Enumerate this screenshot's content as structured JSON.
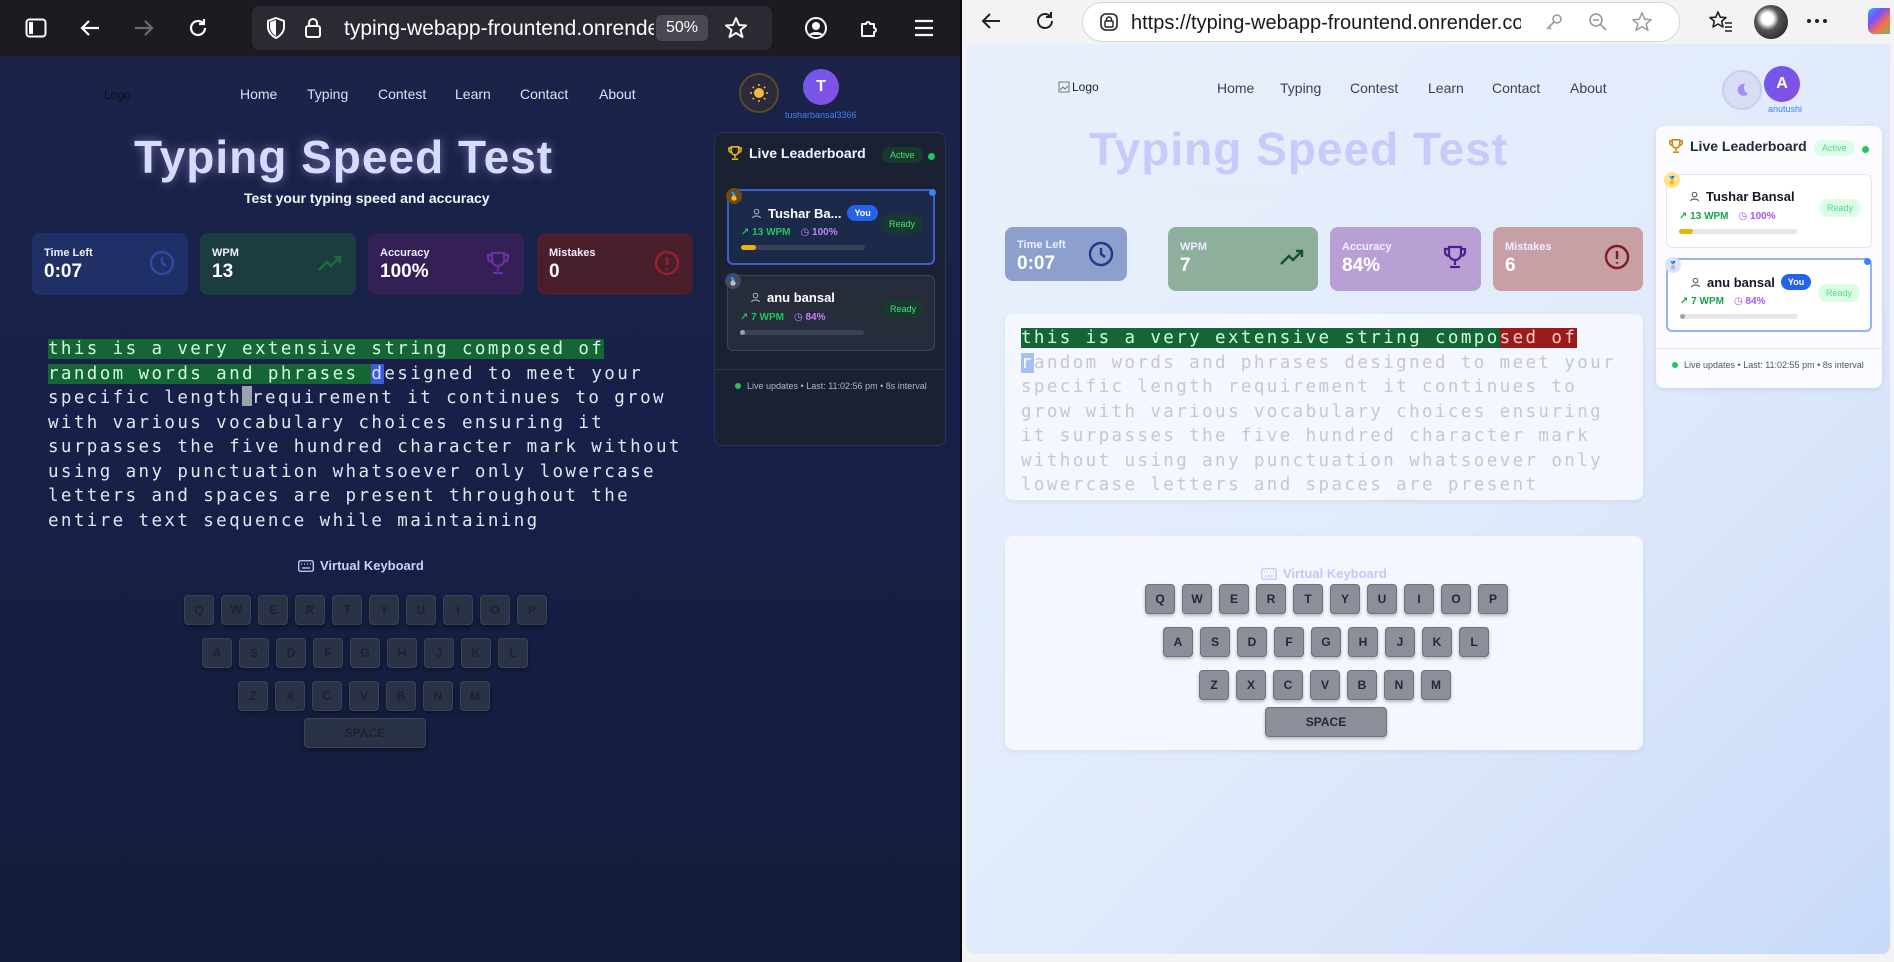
{
  "firefox": {
    "url": "typing-webapp-frountend.onrender.com",
    "zoom": "50%"
  },
  "edge": {
    "url": "https://typing-webapp-frountend.onrender.com"
  },
  "nav": {
    "logo": "Logo",
    "links": [
      "Home",
      "Typing",
      "Contest",
      "Learn",
      "Contact",
      "About"
    ]
  },
  "left": {
    "user_initial": "T",
    "username": "tusharbansal3366",
    "title": "Typing Speed Test",
    "subtitle": "Test your typing speed and accuracy",
    "stats": [
      {
        "label": "Time Left",
        "value": "0:07"
      },
      {
        "label": "WPM",
        "value": "13"
      },
      {
        "label": "Accuracy",
        "value": "100%"
      },
      {
        "label": "Mistakes",
        "value": "0"
      }
    ],
    "typing": {
      "typed": "this is a very extensive string composed of random words and phrases ",
      "current": "d",
      "rest_before_caret": "esigned to meet your specific length",
      "rest_after_caret": "requirement it continues to grow with various vocabulary choices ensuring it surpasses the five hundred character mark without using any punctuation whatsoever only lowercase letters and spaces are present throughout the entire text sequence while maintaining"
    },
    "keyboard_title": "Virtual Keyboard",
    "leaderboard": {
      "title": "Live Leaderboard",
      "status": "Active",
      "players": [
        {
          "name": "Tushar Ba...",
          "you": "You",
          "wpm": "13 WPM",
          "acc": "100%",
          "status": "Ready",
          "progress": 0.12
        },
        {
          "name": "anu bansal",
          "you": "",
          "wpm": "7 WPM",
          "acc": "84%",
          "status": "Ready",
          "progress": 0.04
        }
      ],
      "footer": "Live updates • Last: 11:02:56 pm • 8s interval"
    }
  },
  "right": {
    "user_initial": "A",
    "username": "anutushi",
    "title": "Typing Speed Test",
    "subtitle": "Test your typing speed and accuracy",
    "stats": [
      {
        "label": "Time Left",
        "value": "0:07"
      },
      {
        "label": "WPM",
        "value": "7"
      },
      {
        "label": "Accuracy",
        "value": "84%"
      },
      {
        "label": "Mistakes",
        "value": "6"
      }
    ],
    "typing": {
      "typed_ok": "this is a very extensive string compo",
      "typed_bad": "sed of ",
      "current": "r",
      "rest": "andom words and phrases designed to meet your specific length requirement it continues to grow with various vocabulary choices ensuring it surpasses the five hundred character mark without using any punctuation whatsoever only lowercase letters and spaces are present throughout the entire text sequence while maintaining"
    },
    "keyboard_title": "Virtual Keyboard",
    "leaderboard": {
      "title": "Live Leaderboard",
      "status": "Active",
      "players": [
        {
          "name": "Tushar Bansal",
          "you": "",
          "wpm": "13 WPM",
          "acc": "100%",
          "status": "Ready",
          "progress": 0.12
        },
        {
          "name": "anu bansal",
          "you": "You",
          "wpm": "7 WPM",
          "acc": "84%",
          "status": "Ready",
          "progress": 0.04
        }
      ],
      "footer": "Live updates • Last: 11:02:55 pm • 8s interval"
    }
  },
  "keyboard": {
    "row1": [
      "Q",
      "W",
      "E",
      "R",
      "T",
      "Y",
      "U",
      "I",
      "O",
      "P"
    ],
    "row2": [
      "A",
      "S",
      "D",
      "F",
      "G",
      "H",
      "J",
      "K",
      "L"
    ],
    "row3": [
      "Z",
      "X",
      "C",
      "V",
      "B",
      "N",
      "M"
    ],
    "space": "SPACE"
  },
  "colors": {
    "accent_blue": "#3b82f6",
    "correct_bg": "#166534",
    "error_bg": "#991b1b",
    "active_green": "#22c55e"
  }
}
